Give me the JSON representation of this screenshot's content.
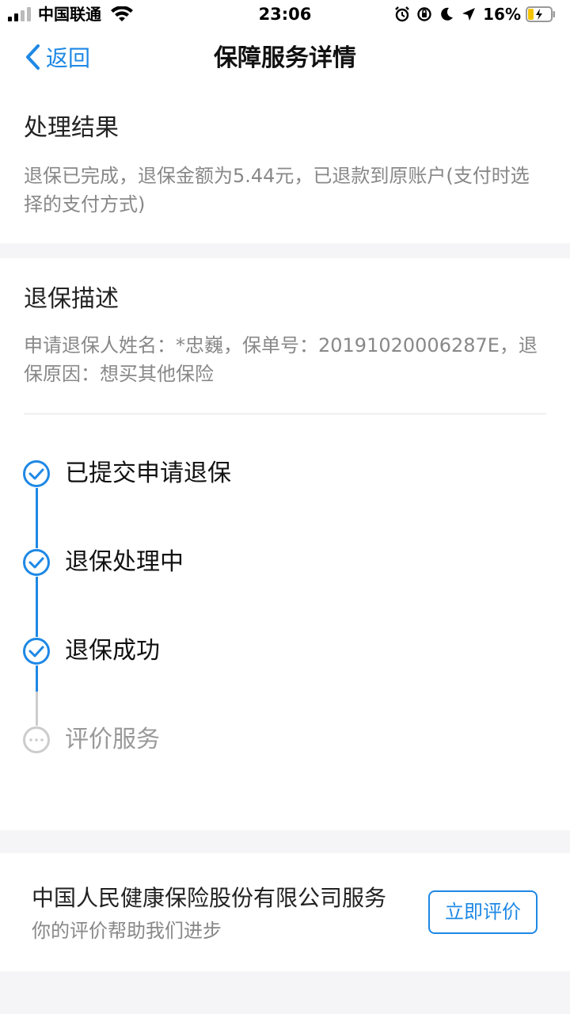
{
  "status_bar": {
    "carrier": "中国联通",
    "time": "23:06",
    "battery": "16%",
    "icons": [
      "signal-icon",
      "wifi-icon",
      "alarm-icon",
      "orientation-lock-icon",
      "moon-icon",
      "location-icon",
      "battery-icon"
    ]
  },
  "nav": {
    "back_label": "返回",
    "title": "保障服务详情"
  },
  "result": {
    "title": "处理结果",
    "body": "退保已完成，退保金额为5.44元，已退款到原账户(支付时选择的支付方式)"
  },
  "description": {
    "title": "退保描述",
    "body": "申请退保人姓名：*忠巍，保单号：20191020006287E，退保原因：想买其他保险"
  },
  "timeline": {
    "steps": [
      {
        "label": "已提交申请退保",
        "status": "done"
      },
      {
        "label": "退保处理中",
        "status": "done"
      },
      {
        "label": "退保成功",
        "status": "done"
      },
      {
        "label": "评价服务",
        "status": "pending"
      }
    ]
  },
  "service": {
    "company": "中国人民健康保险股份有限公司服务",
    "subtitle": "你的评价帮助我们进步",
    "rate_button": "立即评价"
  },
  "colors": {
    "accent": "#1e88e5",
    "pending": "#cccccc",
    "page_bg": "#f5f5f7"
  }
}
